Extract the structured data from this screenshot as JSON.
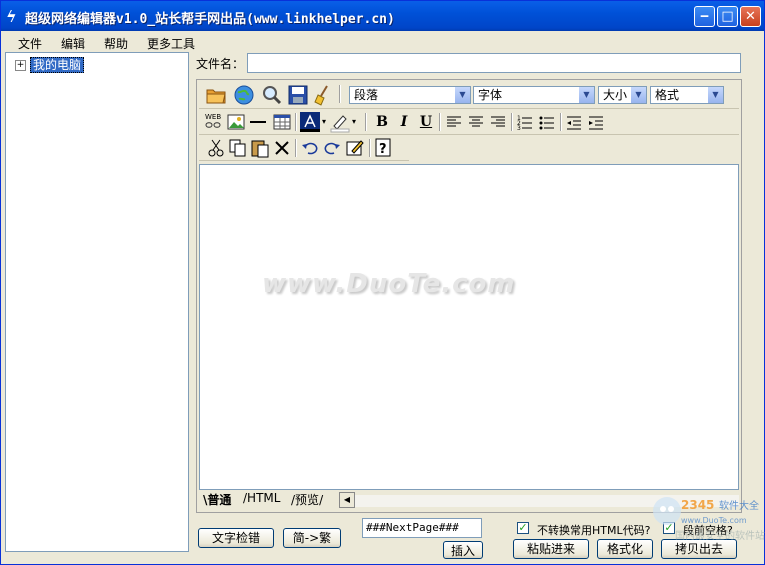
{
  "window": {
    "title": "超级网络编辑器v1.0_站长帮手网出品(www.linkhelper.cn)",
    "app_icon": "lightning-icon",
    "minimize_glyph": "‒",
    "maximize_glyph": "□",
    "close_glyph": "✕"
  },
  "menu": [
    "文件",
    "编辑",
    "帮助",
    "更多工具"
  ],
  "tree": {
    "root_label": "我的电脑",
    "expander": "+"
  },
  "file": {
    "label": "文件名：",
    "value": ""
  },
  "toolbar": {
    "paragraph_select": "段落",
    "font_select": "字体",
    "size_select": "大小",
    "format_select": "格式",
    "bold": "B",
    "italic": "I",
    "underline": "U"
  },
  "editor": {
    "watermark": "www.DuoTe.com"
  },
  "tabs": [
    "普通",
    "HTML",
    "预览"
  ],
  "bottom": {
    "spellcheck_button": "文字检错",
    "convert_button": "简->繁",
    "nextpage_value": "###NextPage###",
    "insert_button": "插入",
    "no_convert_label": "不转换常用HTML代码?",
    "no_convert_checked": true,
    "indent_label": "段前空格?",
    "indent_checked": true,
    "paste_in_button": "粘贴进来",
    "format_button": "格式化",
    "copy_out_button": "拷贝出去"
  },
  "colors": {
    "title_bar": "#0054e3",
    "selection": "#316ac5",
    "face": "#ece9d8"
  }
}
